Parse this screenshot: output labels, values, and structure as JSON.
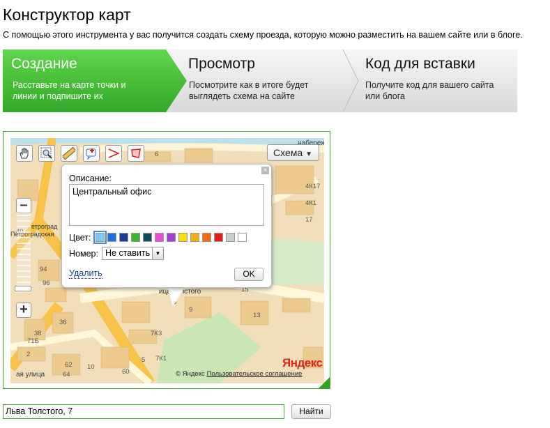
{
  "page": {
    "title": "Конструктор карт",
    "intro": "С помощью этого инструмента у вас получится создать схему проезда, которую можно разместить на вашем сайте или в блоге."
  },
  "steps": [
    {
      "title": "Создание",
      "description": "Расставьте на карте точки и линии и подпишите их",
      "active": true
    },
    {
      "title": "Просмотр",
      "description": "Посмотрите как в итоге будет выглядеть схема на сайте",
      "active": false
    },
    {
      "title": "Код для вставки",
      "description": "Получите код для вашего сайта или блога",
      "active": false
    }
  ],
  "colors": {
    "active_step": "#3fbf2a",
    "frame": "#3aa82c",
    "link": "#1a3d9c"
  },
  "map": {
    "toolbar": [
      "hand-icon",
      "zoom-area-icon",
      "ruler-icon",
      "add-point-icon",
      "add-line-icon",
      "add-polygon-icon"
    ],
    "scheme_button": "Схема",
    "balloon": {
      "description_label": "Описание:",
      "description_value": "Центральный офис",
      "color_label": "Цвет:",
      "colors": [
        "#7ec8f5",
        "#1b6fe0",
        "#1d3b95",
        "#3eb532",
        "#0e4d59",
        "#ea4fd8",
        "#a43fd4",
        "#f4de13",
        "#f2b018",
        "#f26b12",
        "#e0201c",
        "#c8cdd0",
        "#ffffff"
      ],
      "selected_color_index": 0,
      "number_label": "Номер:",
      "number_value": "Не ставить",
      "delete_link": "Удалить",
      "ok_button": "OK"
    },
    "labels": {
      "street_top": "набережн",
      "street_tolstoy": "ица Толстого",
      "street_ulitsa": "ая улица",
      "metro": "Петроградская",
      "metro_partial": "етроград"
    },
    "house_numbers": [
      "6",
      "4К17",
      "4К1",
      "17",
      "8",
      "7К3",
      "9",
      "15",
      "13",
      "5",
      "94",
      "96",
      "40",
      "36",
      "38",
      "71Б",
      "7К1",
      "2",
      "64",
      "62",
      "60",
      "10"
    ],
    "logo": "Яндекс",
    "copyright": "© Яндекс",
    "agreement_link": "Пользовательское соглашение"
  },
  "search": {
    "value": "Льва Толстого, 7",
    "button": "Найти"
  }
}
